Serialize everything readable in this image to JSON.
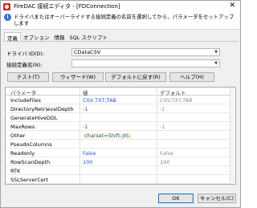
{
  "window": {
    "title": "FireDAC 接続エディタ - [FDConnection]"
  },
  "banner": {
    "text": "ドライバまたはオーバーライドする接続定義の名前を選択してから、パラメータをセットアップします"
  },
  "tabs": [
    {
      "label": "定義"
    },
    {
      "label": "オプション"
    },
    {
      "label": "情報"
    },
    {
      "label": "SQL スクリプト"
    }
  ],
  "form": {
    "driver_id_label": "ドライバ ID(D):",
    "driver_id_value": "CDataCSV",
    "connection_def_label": "接続定義名(N):",
    "connection_def_value": ""
  },
  "buttons": {
    "test": "テスト(T)",
    "wizard": "ウィザード(W)",
    "revert": "デフォルトに戻す(R)",
    "help": "ヘルプ(H)",
    "ok": "OK",
    "cancel": "キャンセル(C)"
  },
  "grid": {
    "columns": [
      "パラメータ",
      "値",
      "デフォルト"
    ],
    "rows": [
      {
        "name": "IncludeFiles",
        "value": "CSV,TXT,TAB",
        "default": "CSV,TXT,TAB"
      },
      {
        "name": "DirectoryRetrievalDepth",
        "value": "-1",
        "default": "-1"
      },
      {
        "name": "GenerateHiveDDL",
        "value": "",
        "default": ""
      },
      {
        "name": "MaxRows",
        "value": "-1",
        "default": "-1"
      },
      {
        "name": "Other",
        "value": "charset=Shift-JIS;",
        "default": ""
      },
      {
        "name": "PseudoColumns",
        "value": "",
        "default": ""
      },
      {
        "name": "Readonly",
        "value": "False",
        "default": "False"
      },
      {
        "name": "RowScanDepth",
        "value": "100",
        "default": "100"
      },
      {
        "name": "RTK",
        "value": "",
        "default": ""
      },
      {
        "name": "SSLServerCert",
        "value": "",
        "default": ""
      }
    ]
  },
  "colors": {
    "accent": "#0078d7",
    "value_blue": "#1a55d4",
    "default_grey": "#8a8a8a"
  }
}
